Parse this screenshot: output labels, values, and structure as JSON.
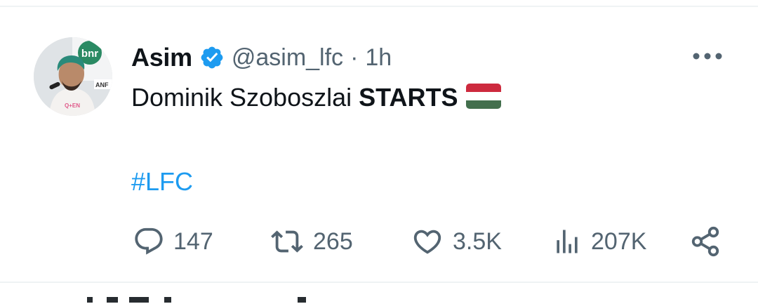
{
  "tweet": {
    "author": {
      "display_name": "Asim",
      "verified": true,
      "handle": "@asim_lfc",
      "separator": "·",
      "time": "1h",
      "avatar_logo_text": "bnr"
    },
    "text_plain": "Dominik Szoboszlai ",
    "text_bold": "STARTS",
    "flag": "Hungary",
    "hashtag": "#LFC",
    "metrics": {
      "replies": "147",
      "reposts": "265",
      "likes": "3.5K",
      "views": "207K"
    }
  },
  "colors": {
    "text_primary": "#0f1419",
    "text_secondary": "#536471",
    "accent": "#1d9bf0",
    "flag_red": "#cd2a3e",
    "flag_white": "#ffffff",
    "flag_green": "#436f4d"
  },
  "icons": {
    "more": "more-horizontal-icon",
    "verified": "verified-badge-icon",
    "reply": "reply-icon",
    "repost": "repost-icon",
    "like": "heart-icon",
    "views": "views-icon",
    "share": "share-icon"
  }
}
